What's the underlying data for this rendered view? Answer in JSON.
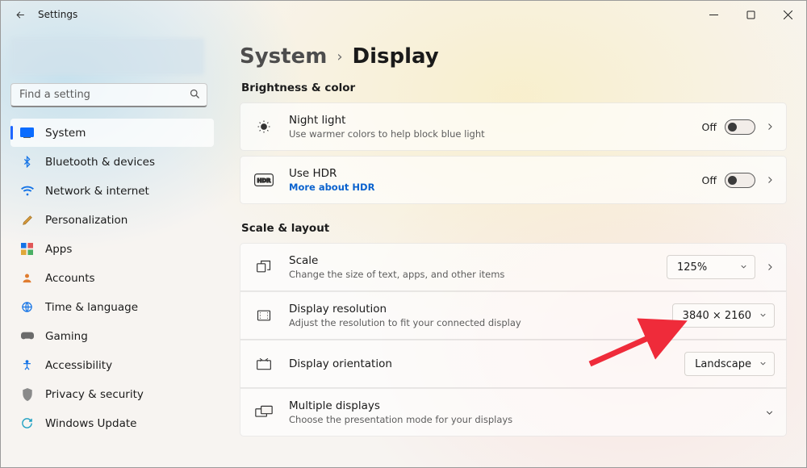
{
  "window": {
    "app_title": "Settings"
  },
  "sidebar": {
    "search_placeholder": "Find a setting",
    "items": [
      {
        "label": "System"
      },
      {
        "label": "Bluetooth & devices"
      },
      {
        "label": "Network & internet"
      },
      {
        "label": "Personalization"
      },
      {
        "label": "Apps"
      },
      {
        "label": "Accounts"
      },
      {
        "label": "Time & language"
      },
      {
        "label": "Gaming"
      },
      {
        "label": "Accessibility"
      },
      {
        "label": "Privacy & security"
      },
      {
        "label": "Windows Update"
      }
    ]
  },
  "main": {
    "breadcrumb_parent": "System",
    "breadcrumb_current": "Display",
    "section_brightness": "Brightness & color",
    "section_scale": "Scale & layout",
    "night_light": {
      "title": "Night light",
      "sub": "Use warmer colors to help block blue light",
      "off_label": "Off"
    },
    "hdr": {
      "title": "Use HDR",
      "link": "More about HDR",
      "off_label": "Off"
    },
    "scale": {
      "title": "Scale",
      "sub": "Change the size of text, apps, and other items",
      "value": "125%"
    },
    "resolution": {
      "title": "Display resolution",
      "sub": "Adjust the resolution to fit your connected display",
      "value": "3840 × 2160"
    },
    "orientation": {
      "title": "Display orientation",
      "value": "Landscape"
    },
    "multiple": {
      "title": "Multiple displays",
      "sub": "Choose the presentation mode for your displays"
    }
  }
}
